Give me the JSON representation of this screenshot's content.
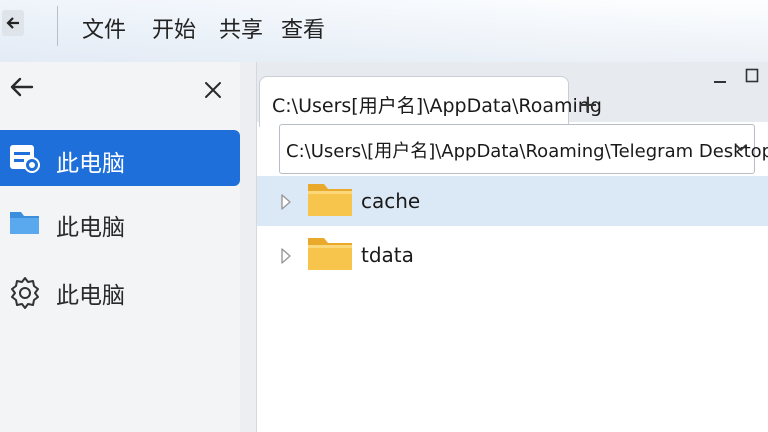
{
  "menubar": {
    "items": [
      "文件",
      "开始",
      "共享",
      "查看"
    ]
  },
  "sidebar": {
    "items": [
      {
        "label": "此电脑",
        "icon": "drive-icon",
        "active": true
      },
      {
        "label": "此电脑",
        "icon": "folder-icon",
        "active": false
      },
      {
        "label": "此电脑",
        "icon": "settings-icon",
        "active": false
      }
    ]
  },
  "tabs": [
    {
      "label": "C:\\Users[用户名]\\AppData\\Roaming"
    }
  ],
  "tab_add_label": "+",
  "address": {
    "value": "C:\\Users\\[用户名]\\AppData\\Roaming\\Telegram Desktop"
  },
  "files": [
    {
      "name": "cache",
      "type": "folder",
      "selected": true
    },
    {
      "name": "tdata",
      "type": "folder",
      "selected": false
    }
  ],
  "colors": {
    "accent": "#1e6fd9",
    "selection": "#dbe8f5",
    "folder": "#f5c242"
  }
}
